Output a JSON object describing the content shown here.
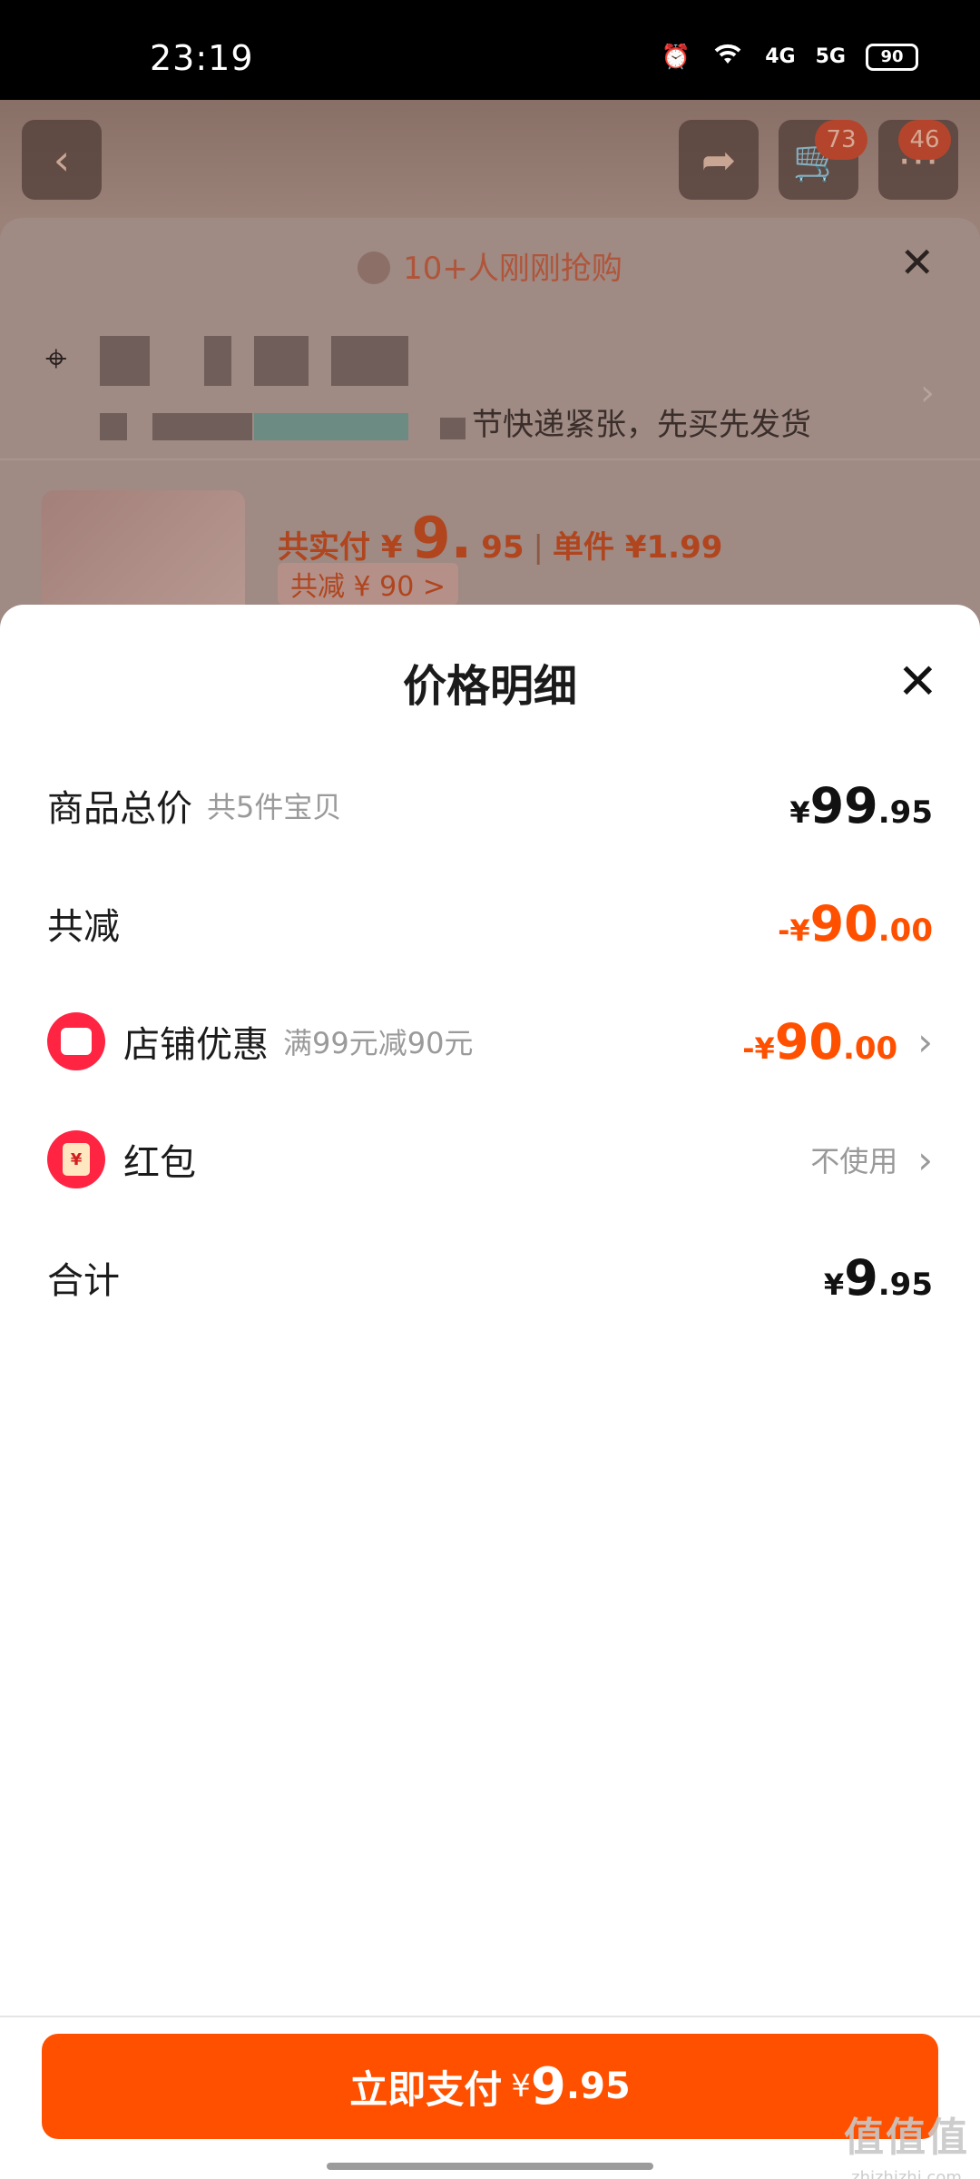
{
  "status_bar": {
    "time": "23:19",
    "network_1": "4G",
    "network_2": "5G",
    "battery": "90"
  },
  "background": {
    "cart_badge": "73",
    "more_badge": "46",
    "banner": "10+人刚刚抢购",
    "address_tail": "节快递紧张，先买先发货",
    "pay_summary": {
      "prefix": "共实付 ¥",
      "amount_int": "9.",
      "amount_dec": "95",
      "unit_label": "单件 ¥1.99"
    },
    "reduce_tag": "共减 ¥ 90 >"
  },
  "sheet": {
    "title": "价格明细",
    "rows": [
      {
        "label": "商品总价",
        "sub": "共5件宝贝",
        "cur": "¥",
        "int": "99",
        "dec": ".95"
      },
      {
        "label": "共减",
        "cur": "-¥",
        "int": "90",
        "dec": ".00"
      },
      {
        "label": "店铺优惠",
        "sub": "满99元减90元",
        "cur": "-¥",
        "int": "90",
        "dec": ".00"
      },
      {
        "label": "红包",
        "right_text": "不使用"
      },
      {
        "label": "合计",
        "cur": "¥",
        "int": "9",
        "dec": ".95"
      }
    ]
  },
  "bottom": {
    "pay_label": "立即支付",
    "cur": "¥",
    "int": "9",
    "dec": ".95"
  },
  "watermark": {
    "main": "值值值",
    "sub": "zhizhizhi.com"
  },
  "colors": {
    "accent": "#ff5000",
    "icon_red": "#ff2442"
  }
}
